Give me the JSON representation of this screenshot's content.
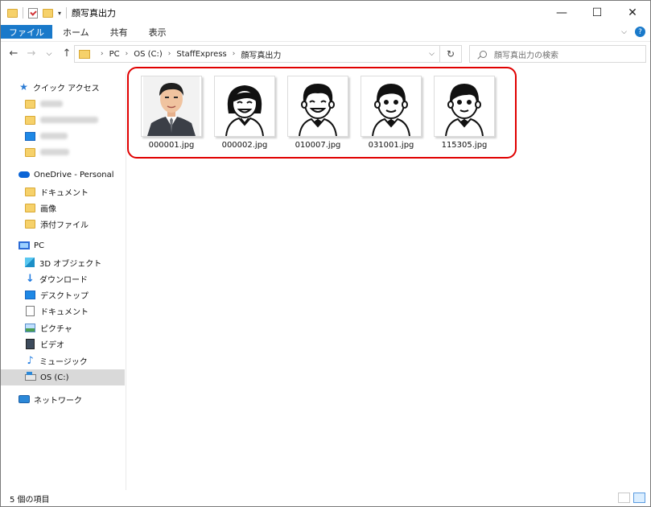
{
  "window": {
    "title": "顔写真出力",
    "controls": {
      "minimize": "—",
      "maximize": "☐",
      "close": "✕"
    }
  },
  "ribbon": {
    "tabs": [
      {
        "label": "ファイル"
      },
      {
        "label": "ホーム"
      },
      {
        "label": "共有"
      },
      {
        "label": "表示"
      }
    ],
    "help": "?"
  },
  "address": {
    "crumbs": [
      "PC",
      "OS (C:)",
      "StaffExpress",
      "顔写真出力"
    ],
    "refresh": "↻"
  },
  "search": {
    "placeholder": "顔写真出力の検索"
  },
  "nav": {
    "quick_access": "クイック アクセス",
    "onedrive": "OneDrive - Personal",
    "onedrive_items": [
      "ドキュメント",
      "画像",
      "添付ファイル"
    ],
    "pc": "PC",
    "pc_items": [
      "3D オブジェクト",
      "ダウンロード",
      "デスクトップ",
      "ドキュメント",
      "ピクチャ",
      "ビデオ",
      "ミュージック",
      "OS (C:)"
    ],
    "network": "ネットワーク"
  },
  "files": [
    {
      "name": "000001.jpg"
    },
    {
      "name": "000002.jpg"
    },
    {
      "name": "010007.jpg"
    },
    {
      "name": "031001.jpg"
    },
    {
      "name": "115305.jpg"
    }
  ],
  "status": {
    "count": "5 個の項目"
  },
  "colors": {
    "accent": "#1979ca",
    "highlight": "#e00000",
    "folder": "#f6d16a"
  }
}
